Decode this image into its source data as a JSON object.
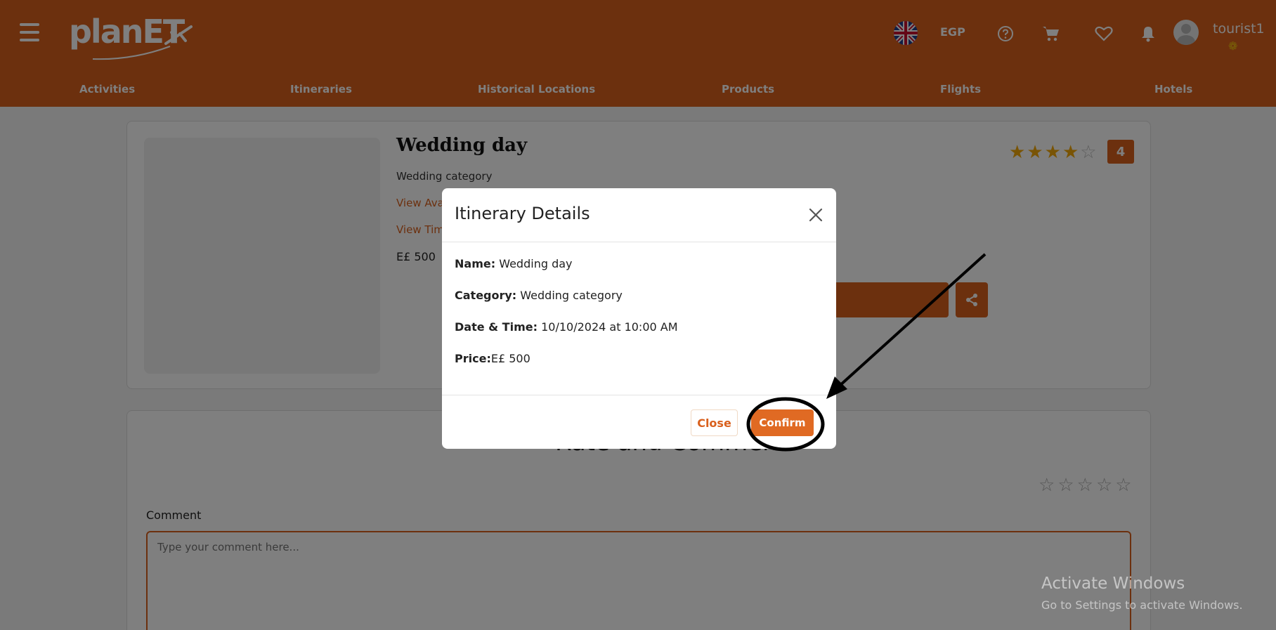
{
  "header": {
    "logo_text": "planET",
    "currency": "EGP",
    "username": "tourist1",
    "icons": [
      "question-icon",
      "cart-icon",
      "heart-icon",
      "bell-icon"
    ]
  },
  "nav": {
    "items": [
      "Activities",
      "Itineraries",
      "Historical Locations",
      "Products",
      "Flights",
      "Hotels"
    ]
  },
  "itinerary": {
    "title": "Wedding day",
    "category": "Wedding category",
    "link_availability": "View Ava",
    "link_timeline": "View Tim",
    "price": "E£ 500",
    "rating": "4",
    "rating_value": 4,
    "rating_max": 5
  },
  "review": {
    "heading": "Rate and Comment",
    "comment_label": "Comment",
    "comment_placeholder": "Type your comment here..."
  },
  "modal": {
    "title": "Itinerary Details",
    "name_label": "Name:",
    "name_value": "Wedding day",
    "category_label": "Category:",
    "category_value": "Wedding category",
    "datetime_label": "Date & Time:",
    "datetime_value": "10/10/2024 at 10:00 AM",
    "price_label": "Price:",
    "price_value": "E£ 500",
    "close_label": "Close",
    "confirm_label": "Confirm"
  },
  "watermark": {
    "line1": "Activate Windows",
    "line2": "Go to Settings to activate Windows."
  },
  "colors": {
    "brand": "#d9601d",
    "star": "#f2a90a"
  }
}
